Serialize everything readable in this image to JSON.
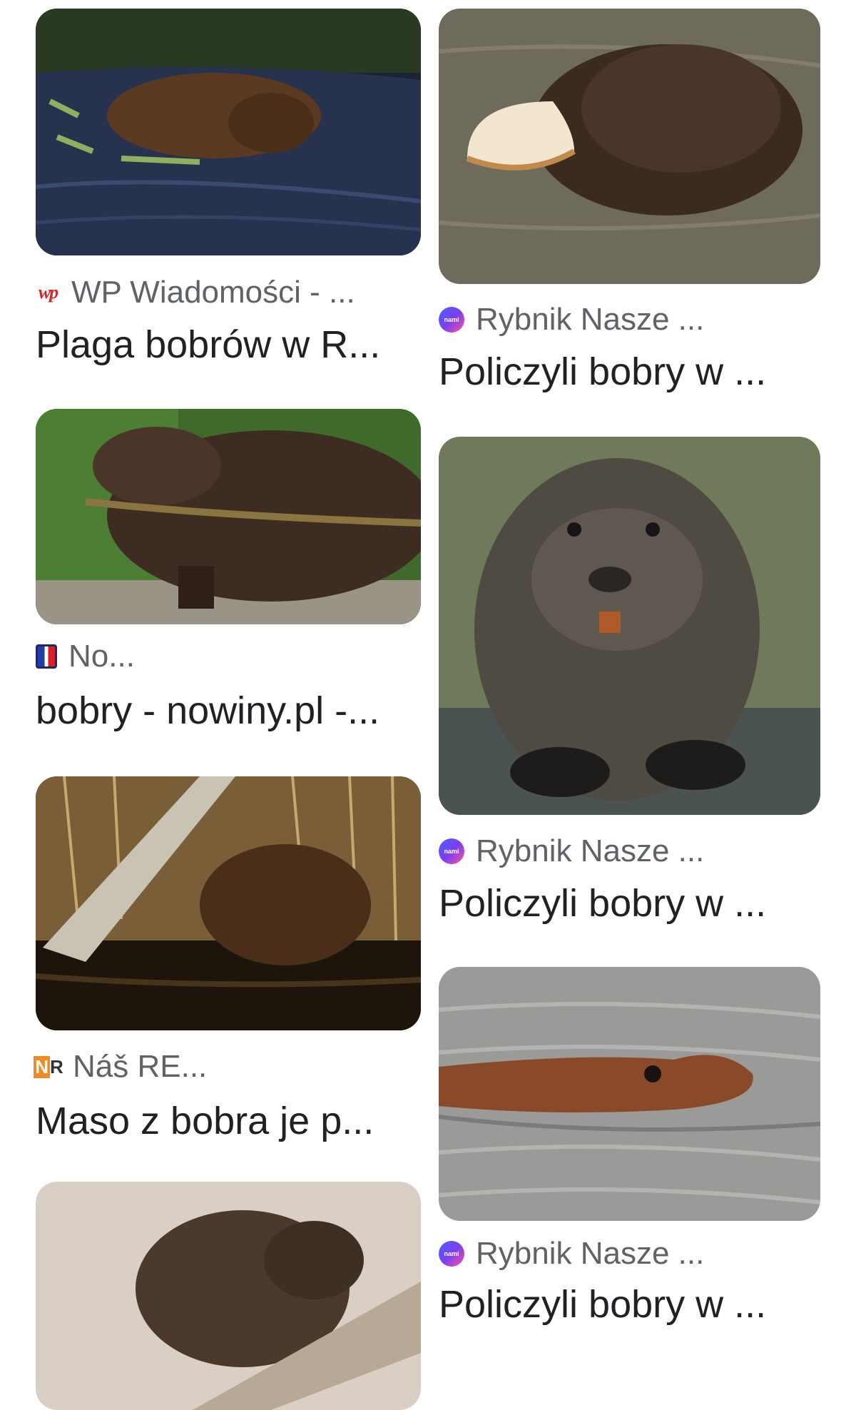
{
  "results": [
    {
      "source": "WP Wiadomości - ...",
      "favicon": "wp-logo-icon",
      "title": "Plaga bobrów w R..."
    },
    {
      "source": "Rybnik Nasze ...",
      "favicon": "nami-logo-icon",
      "title": "Policzyli bobry w ..."
    },
    {
      "source": "No...",
      "favicon": "nowiny-logo-icon",
      "title": "bobry - nowiny.pl -..."
    },
    {
      "source": "Rybnik Nasze ...",
      "favicon": "nami-logo-icon",
      "title": "Policzyli bobry w ..."
    },
    {
      "source": "Náš RE...",
      "favicon": "nr-logo-icon",
      "title": "Maso z bobra je p..."
    },
    {
      "source": "Rybnik Nasze ...",
      "favicon": "nami-logo-icon",
      "title": "Policzyli bobry w ..."
    }
  ],
  "colors": {
    "source_text": "#5f6368",
    "title_text": "#202124",
    "wp_red": "#d6262b",
    "nami_gradient": "#4a63ff"
  }
}
